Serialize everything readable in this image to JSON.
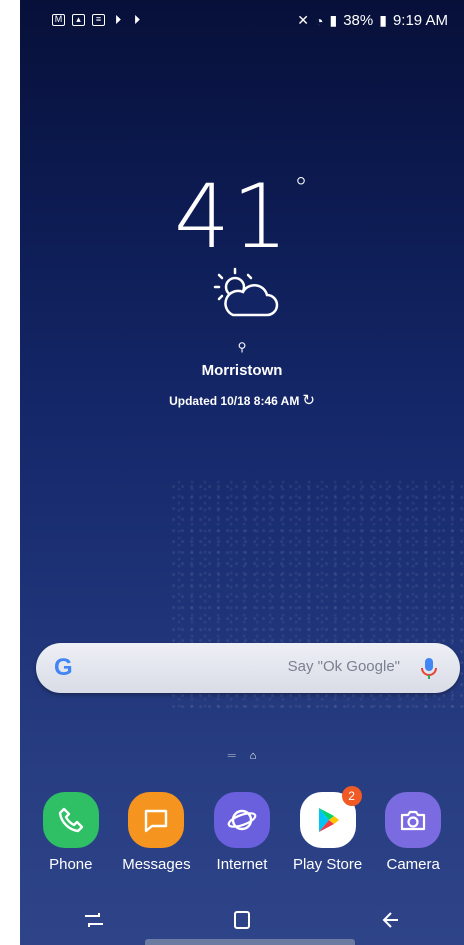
{
  "status_bar": {
    "notification_icons": [
      "gmail-icon",
      "gallery-icon",
      "notepad-icon",
      "play-icon",
      "play-icon"
    ],
    "battery": "38%",
    "time": "9:19 AM"
  },
  "weather": {
    "temperature": "41",
    "degree_symbol": "°",
    "condition_icon": "partly-sunny-icon",
    "location": "Morristown",
    "updated": "Updated 10/18 8:46 AM"
  },
  "search": {
    "logo": "G",
    "hint": "Say \"Ok Google\""
  },
  "dock": {
    "apps": [
      {
        "label": "Phone",
        "icon": "phone-icon",
        "color": "#2fbf65"
      },
      {
        "label": "Messages",
        "icon": "messages-icon",
        "color": "#f5951f"
      },
      {
        "label": "Internet",
        "icon": "internet-icon",
        "color": "#6a5fdc"
      },
      {
        "label": "Play Store",
        "icon": "play-store-icon",
        "color": "#ffffff",
        "badge": "2"
      },
      {
        "label": "Camera",
        "icon": "camera-icon",
        "color": "#7b6be0"
      }
    ]
  },
  "colors": {
    "accent_badge": "#f05a24",
    "google_blue": "#4285f4"
  }
}
